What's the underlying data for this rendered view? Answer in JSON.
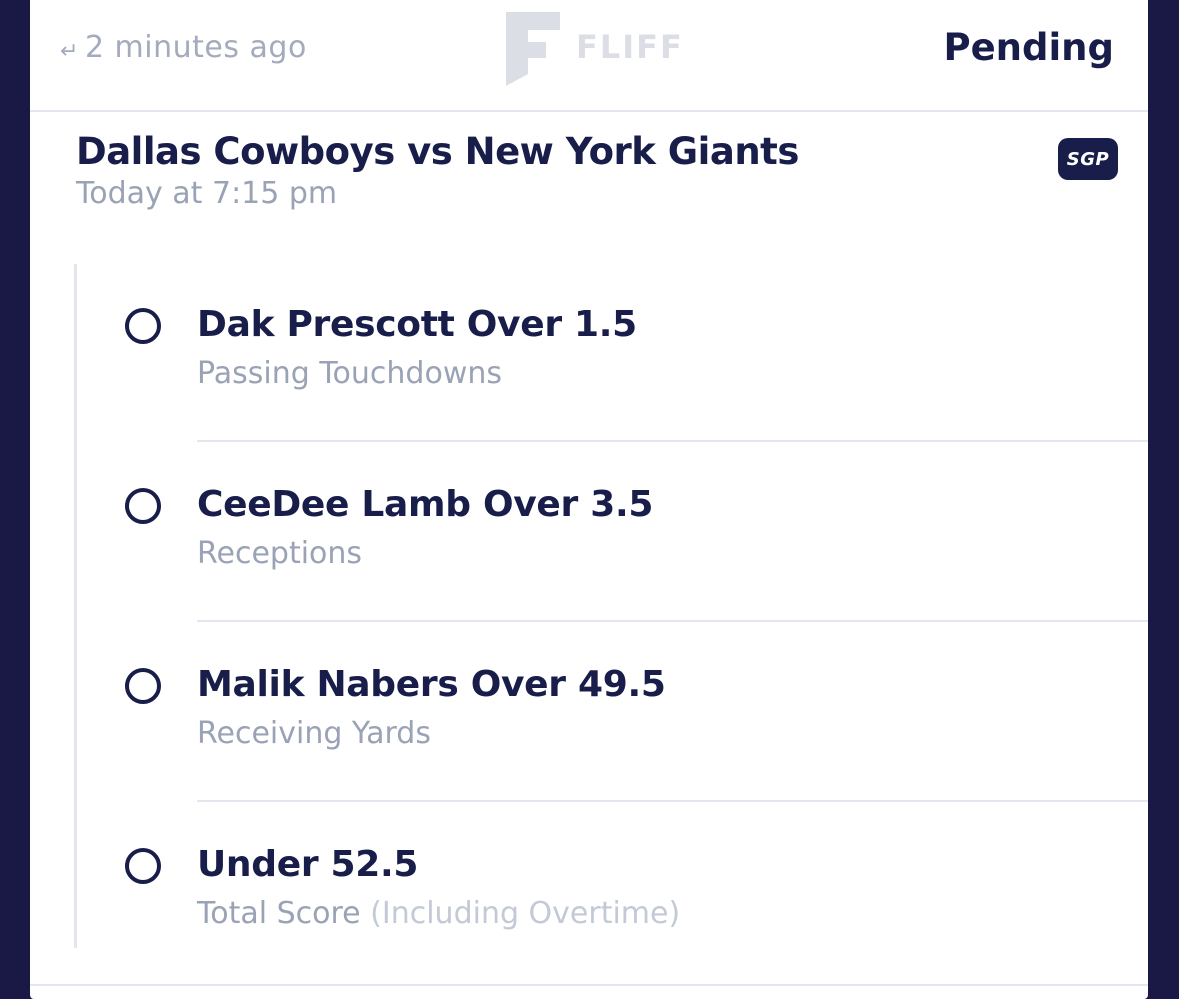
{
  "header": {
    "return_icon": "return-arrow-icon",
    "time_ago": "2 minutes ago",
    "logo_text": "FLIFF",
    "status": "Pending"
  },
  "game": {
    "title": "Dallas Cowboys vs New York Giants",
    "time": "Today at 7:15 pm",
    "badge": "SGP"
  },
  "legs": [
    {
      "title": "Dak Prescott Over 1.5",
      "subtitle": "Passing Touchdowns",
      "subtitle_extra": ""
    },
    {
      "title": "CeeDee Lamb Over 3.5",
      "subtitle": "Receptions",
      "subtitle_extra": ""
    },
    {
      "title": "Malik Nabers Over 49.5",
      "subtitle": "Receiving Yards",
      "subtitle_extra": ""
    },
    {
      "title": "Under 52.5",
      "subtitle": "Total Score",
      "subtitle_extra": " (Including Overtime)"
    }
  ],
  "colors": {
    "background": "#1a1844",
    "primary_text": "#181d4a",
    "muted_text": "#9aa3b6",
    "divider": "#e3e6ee"
  }
}
